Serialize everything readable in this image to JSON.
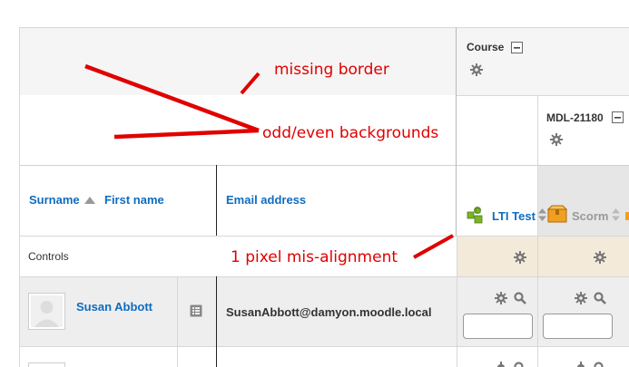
{
  "header": {
    "course_label": "Course",
    "category_label": "MDL-21180"
  },
  "columns": {
    "surname": "Surname",
    "first_name": "First name",
    "email": "Email address",
    "lti_item": "LTI Test",
    "scorm_item": "Scorm"
  },
  "rows": {
    "controls_label": "Controls",
    "user_name": "Susan Abbott",
    "user_email": "SusanAbbott@damyon.moodle.local"
  },
  "annotations": {
    "missing_border": "missing border",
    "odd_even": "odd/even backgrounds",
    "misalignment": "1 pixel mis-alignment"
  },
  "colors": {
    "annotation": "#e00000",
    "link": "#0f6cbf",
    "header_bg": "#f5f5f5",
    "controls_bg": "#f3ead9",
    "row_bg": "#eeeeee",
    "scorm_header_bg": "#e6e6e6"
  },
  "icons": {
    "collapse": "collapse-icon",
    "gear": "gear-icon",
    "search": "search-icon",
    "sort": "sort-ascending-icon",
    "lti": "puzzle-icon",
    "scorm": "package-icon",
    "report": "report-icon",
    "avatar": "avatar"
  }
}
